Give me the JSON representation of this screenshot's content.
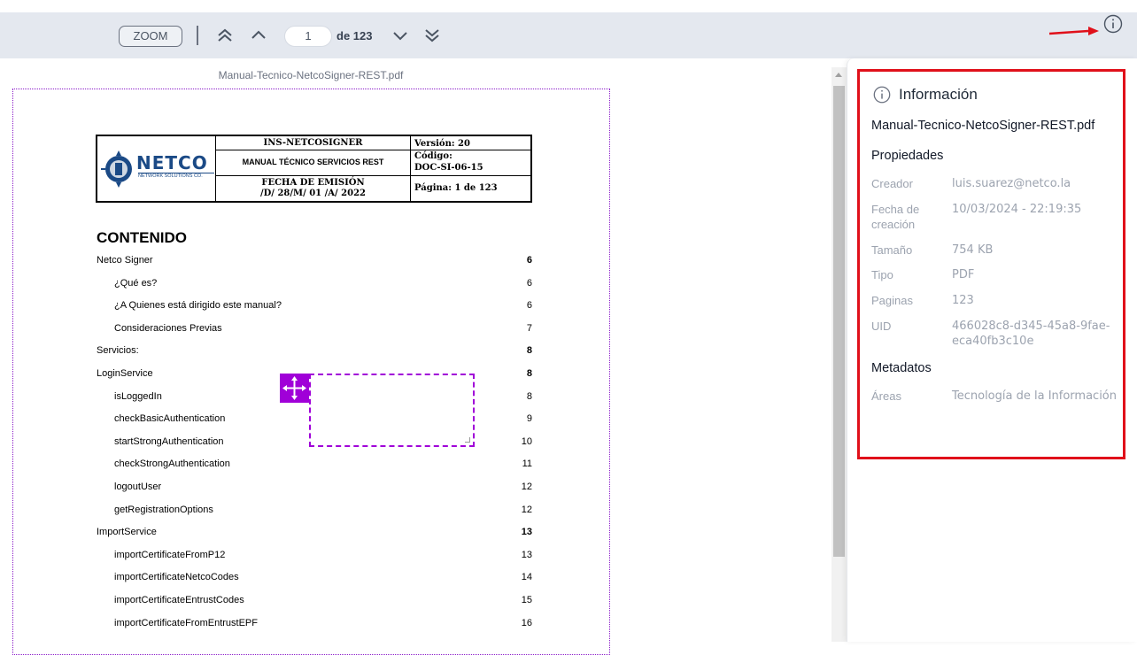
{
  "toolbar": {
    "zoom_label": "ZOOM",
    "page_current": "1",
    "page_total_label": "de 123",
    "icons": [
      "first-page-icon",
      "previous-page-icon",
      "next-page-icon",
      "last-page-icon",
      "info-icon"
    ]
  },
  "document": {
    "filename": "Manual-Tecnico-NetcoSigner-REST.pdf",
    "header": {
      "logo_text": "NETCO",
      "logo_sub": "NETWORK SOLUTIONS CO.",
      "row1_title": "INS-NETCOSIGNER",
      "row1_version": "Versión: 20",
      "row2_title": "MANUAL TÉCNICO SERVICIOS REST",
      "row2_code_label": "Código:",
      "row2_code": "DOC-SI-06-15",
      "row3_title_1": "FECHA DE EMISIÓN",
      "row3_title_2": "/D/ 28/M/ 01 /A/ 2022",
      "row3_page": "Página: 1 de 123"
    },
    "contents_title": "CONTENIDO",
    "toc": [
      {
        "label": "Netco Signer",
        "page": "6",
        "indent": false,
        "bold_page": true
      },
      {
        "label": "¿Qué es?",
        "page": "6",
        "indent": true,
        "bold_page": false
      },
      {
        "label": "¿A Quienes está dirigido este manual?",
        "page": "6",
        "indent": true,
        "bold_page": false
      },
      {
        "label": "Consideraciones Previas",
        "page": "7",
        "indent": true,
        "bold_page": false
      },
      {
        "label": "Servicios:",
        "page": "8",
        "indent": false,
        "bold_page": true
      },
      {
        "label": "LoginService",
        "page": "8",
        "indent": false,
        "bold_page": true
      },
      {
        "label": "isLoggedIn",
        "page": "8",
        "indent": true,
        "bold_page": false
      },
      {
        "label": "checkBasicAuthentication",
        "page": "9",
        "indent": true,
        "bold_page": false
      },
      {
        "label": "startStrongAuthentication",
        "page": "10",
        "indent": true,
        "bold_page": false
      },
      {
        "label": "checkStrongAuthentication",
        "page": "11",
        "indent": true,
        "bold_page": false
      },
      {
        "label": "logoutUser",
        "page": "12",
        "indent": true,
        "bold_page": false
      },
      {
        "label": "getRegistrationOptions",
        "page": "12",
        "indent": true,
        "bold_page": false
      },
      {
        "label": "ImportService",
        "page": "13",
        "indent": false,
        "bold_page": true
      },
      {
        "label": "importCertificateFromP12",
        "page": "13",
        "indent": true,
        "bold_page": false
      },
      {
        "label": "importCertificateNetcoCodes",
        "page": "14",
        "indent": true,
        "bold_page": false
      },
      {
        "label": "importCertificateEntrustCodes",
        "page": "15",
        "indent": true,
        "bold_page": false
      },
      {
        "label": "importCertificateFromEntrustEPF",
        "page": "16",
        "indent": true,
        "bold_page": false
      }
    ]
  },
  "panel": {
    "title": "Información",
    "filename": "Manual-Tecnico-NetcoSigner-REST.pdf",
    "properties_title": "Propiedades",
    "properties": [
      {
        "key": "Creador",
        "value": "luis.suarez@netco.la"
      },
      {
        "key": "Fecha de creación",
        "value": "10/03/2024 - 22:19:35"
      },
      {
        "key": "Tamaño",
        "value": "754 KB"
      },
      {
        "key": "Tipo",
        "value": "PDF"
      },
      {
        "key": "Paginas",
        "value": "123"
      },
      {
        "key": "UID",
        "value": "466028c8-d345-45a8-9fae-eca40fb3c10e"
      }
    ],
    "metadata_title": "Metadatos",
    "metadata": [
      {
        "key": "Áreas",
        "value": "Tecnología de la Información"
      }
    ]
  },
  "colors": {
    "toolbar_bg": "#e4e8ef",
    "selection": "#a000d8",
    "annotation_red": "#e0101a"
  }
}
